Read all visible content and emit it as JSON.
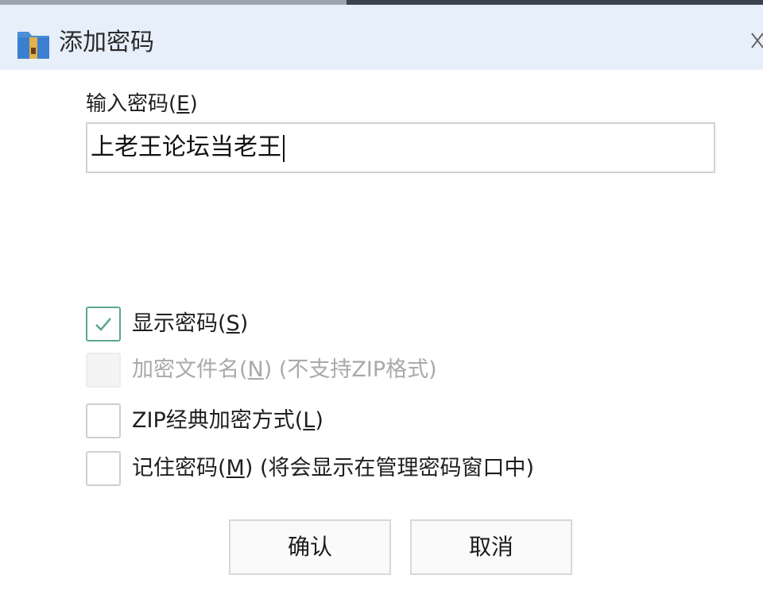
{
  "window": {
    "title": "添加密码",
    "app_icon": "archive-folder-icon",
    "close_icon": "close-icon"
  },
  "password": {
    "label_prefix": "输入密码(",
    "label_key": "E",
    "label_suffix": ")",
    "value": "上老王论坛当老王"
  },
  "options": [
    {
      "prefix": "显示密码(",
      "key": "S",
      "suffix": ")",
      "checked": true,
      "enabled": true
    },
    {
      "prefix": "加密文件名(",
      "key": "N",
      "suffix": ") (不支持ZIP格式)",
      "checked": false,
      "enabled": false
    },
    {
      "prefix": "ZIP经典加密方式(",
      "key": "L",
      "suffix": ")",
      "checked": false,
      "enabled": true
    },
    {
      "prefix": "记住密码(",
      "key": "M",
      "suffix": ") (将会显示在管理密码窗口中)",
      "checked": false,
      "enabled": true
    }
  ],
  "buttons": {
    "ok": "确认",
    "cancel": "取消"
  },
  "colors": {
    "titlebar_bg": "#e6effa",
    "check_accent": "#5aa88c",
    "disabled_text": "#a9a9a9"
  }
}
